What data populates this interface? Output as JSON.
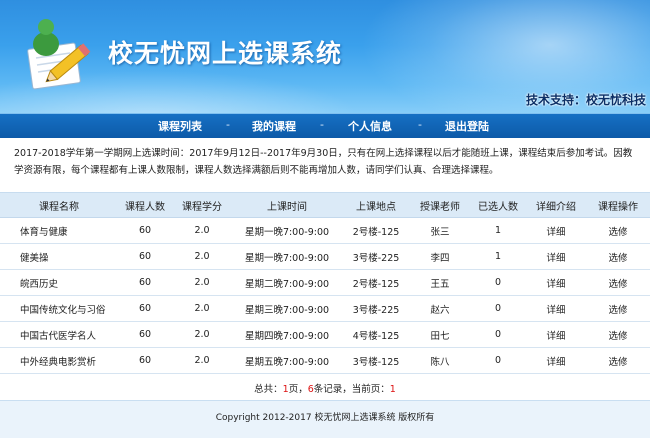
{
  "header": {
    "site_title": "校无忧网上选课系统",
    "support_text": "技术支持：校无忧科技"
  },
  "nav": {
    "items": [
      "课程列表",
      "我的课程",
      "个人信息",
      "退出登陆"
    ],
    "separator": "-"
  },
  "notice": {
    "text": "2017-2018学年第一学期网上选课时间：2017年9月12日--2017年9月30日，只有在网上选择课程以后才能随班上课，课程结束后参加考试。因教学资源有限，每个课程都有上课人数限制，课程人数选择满额后则不能再增加人数，请同学们认真、合理选择课程。"
  },
  "table": {
    "columns": [
      "课程名称",
      "课程人数",
      "课程学分",
      "上课时间",
      "上课地点",
      "授课老师",
      "已选人数",
      "详细介绍",
      "课程操作"
    ],
    "rows": [
      [
        "体育与健康",
        "60",
        "2.0",
        "星期一晚7:00-9:00",
        "2号楼-125",
        "张三",
        "1",
        "详细",
        "选修"
      ],
      [
        "健美操",
        "60",
        "2.0",
        "星期一晚7:00-9:00",
        "3号楼-225",
        "李四",
        "1",
        "详细",
        "选修"
      ],
      [
        "皖西历史",
        "60",
        "2.0",
        "星期二晚7:00-9:00",
        "2号楼-125",
        "王五",
        "0",
        "详细",
        "选修"
      ],
      [
        "中国传统文化与习俗",
        "60",
        "2.0",
        "星期三晚7:00-9:00",
        "3号楼-225",
        "赵六",
        "0",
        "详细",
        "选修"
      ],
      [
        "中国古代医学名人",
        "60",
        "2.0",
        "星期四晚7:00-9:00",
        "4号楼-125",
        "田七",
        "0",
        "详细",
        "选修"
      ],
      [
        "中外经典电影赏析",
        "60",
        "2.0",
        "星期五晚7:00-9:00",
        "3号楼-125",
        "陈八",
        "0",
        "详细",
        "选修"
      ]
    ]
  },
  "pager": {
    "label_total": "总共：",
    "pages": "1",
    "label_pages_unit": "页，",
    "records": "6",
    "label_records_unit": "条记录，当前页：",
    "current": "1"
  },
  "footer": {
    "copyright": "Copyright 2012-2017 校无忧网上选课系统 版权所有"
  },
  "colors": {
    "banner_top": "#2f8fe0",
    "nav_bg": "#0d5aa8",
    "table_header_bg": "#dbeaf7",
    "pager_highlight": "#dd1111"
  }
}
